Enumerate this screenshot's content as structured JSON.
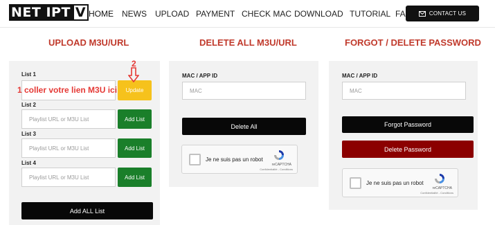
{
  "header": {
    "logo_part1": "NET IPT",
    "logo_part2": "V",
    "nav": [
      "HOME",
      "NEWS",
      "UPLOAD",
      "PAYMENT",
      "CHECK MAC",
      "DOWNLOAD",
      "TUTORIAL",
      "FAQ'S"
    ],
    "contact_label": "CONTACT US"
  },
  "upload": {
    "title": "UPLOAD M3U/URL",
    "lists": [
      {
        "label": "List 1",
        "value": "",
        "button": "Update"
      },
      {
        "label": "List 2",
        "placeholder": "Playlist URL or M3U List",
        "button": "Add List"
      },
      {
        "label": "List 3",
        "placeholder": "Playlist URL or M3U List",
        "button": "Add List"
      },
      {
        "label": "List 4",
        "placeholder": "Playlist URL or M3U List",
        "button": "Add List"
      }
    ],
    "add_all_label": "Add ALL List",
    "annotation_text": "1 coller votre lien M3U ici",
    "annotation_step": "2"
  },
  "delete_all": {
    "title": "DELETE ALL M3U/URL",
    "mac_label": "MAC / APP ID",
    "mac_placeholder": "MAC",
    "button": "Delete All"
  },
  "forgot": {
    "title": "FORGOT / DELETE PASSWORD",
    "mac_label": "MAC / APP ID",
    "mac_placeholder": "MAC",
    "forgot_button": "Forgot Password",
    "delete_button": "Delete Password"
  },
  "captcha": {
    "text": "Je ne suis pas un robot",
    "brand": "reCAPTCHA",
    "terms": "Confidentialité - Conditions"
  },
  "colors": {
    "accent_red": "#c0392b",
    "green": "#1a7f2a",
    "yellow": "#f6c21c",
    "dark_red": "#8b0000"
  }
}
